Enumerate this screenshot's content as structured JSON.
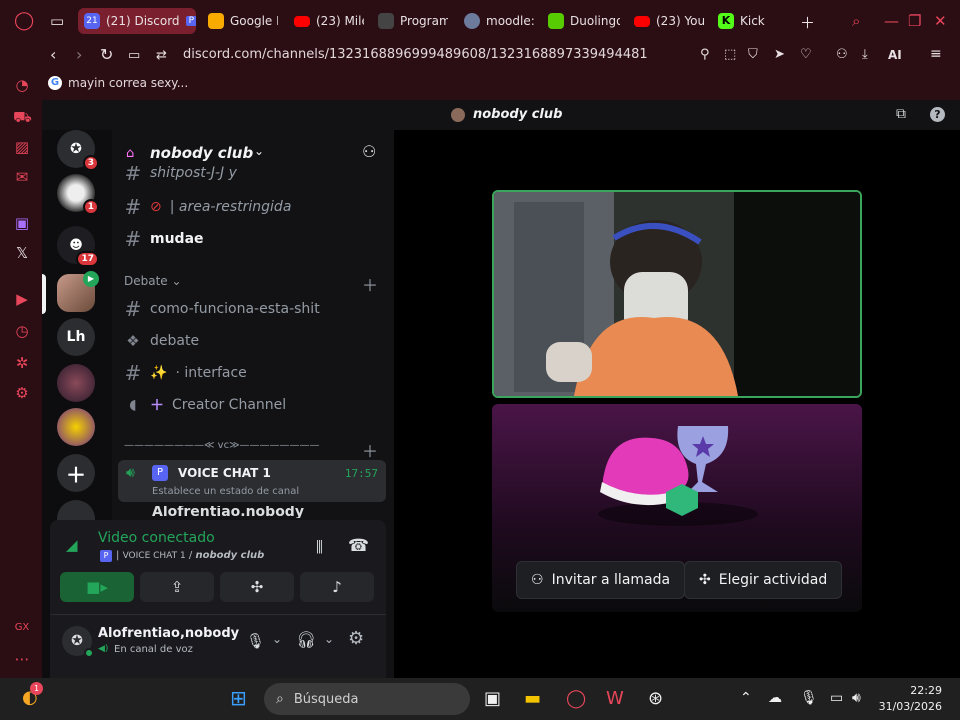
{
  "browser": {
    "tabs": [
      {
        "label": "(21) Discord",
        "color": "#5865f2"
      },
      {
        "label": "Google K",
        "color": "#f9ab00"
      },
      {
        "label": "(23) Mile",
        "color": "#ff0000"
      },
      {
        "label": "Program",
        "color": "#444444"
      },
      {
        "label": "moodle:",
        "color": "#6c7a9c"
      },
      {
        "label": "Duolingo",
        "color": "#58cc02"
      },
      {
        "label": "(23) You",
        "color": "#ff0000"
      },
      {
        "label": "Kick",
        "color": "#53fc18"
      }
    ],
    "active_tab_badge": "21",
    "url": "discord.com/channels/1323168896999489608/1323168897339494481",
    "bookmark": "mayin correa sexy...",
    "ai_label": "AI",
    "accent": "#e8465a"
  },
  "discord": {
    "topbar_title": "nobody club",
    "servers": [
      {
        "badge": "3"
      },
      {
        "badge": "1"
      },
      {
        "badge": "17"
      },
      {
        "badge": ""
      },
      {
        "label": "Lh"
      }
    ],
    "guild_name": "nobody club",
    "channels": {
      "partial_top": "shitpost-J-J y",
      "area": "| area-restringida",
      "mudae": "mudae",
      "category_debate": "Debate",
      "como": "como-funciona-esta-shit",
      "debate": "debate",
      "interface": "· interface",
      "creator": "Creator Channel",
      "vc_divider": "————————≪ vc≫————————",
      "vc_name": "VOICE CHAT 1",
      "vc_time": "17:57",
      "vc_status": "Establece un estado de canal",
      "partial_user": "Alofrentiao.nobody"
    },
    "voice_panel": {
      "status": "Video conectado",
      "channel_line_a": "VOICE CHAT 1",
      "channel_line_b": "nobody club",
      "username": "Alofrentiao,nobody",
      "substatus": "En canal de voz"
    },
    "stage": {
      "invite_label": "Invitar a llamada",
      "activity_label": "Elegir actividad"
    }
  },
  "taskbar": {
    "search_placeholder": "Búsqueda",
    "time": "22:29",
    "date": "31/03/2026",
    "weather_badge": "1"
  }
}
